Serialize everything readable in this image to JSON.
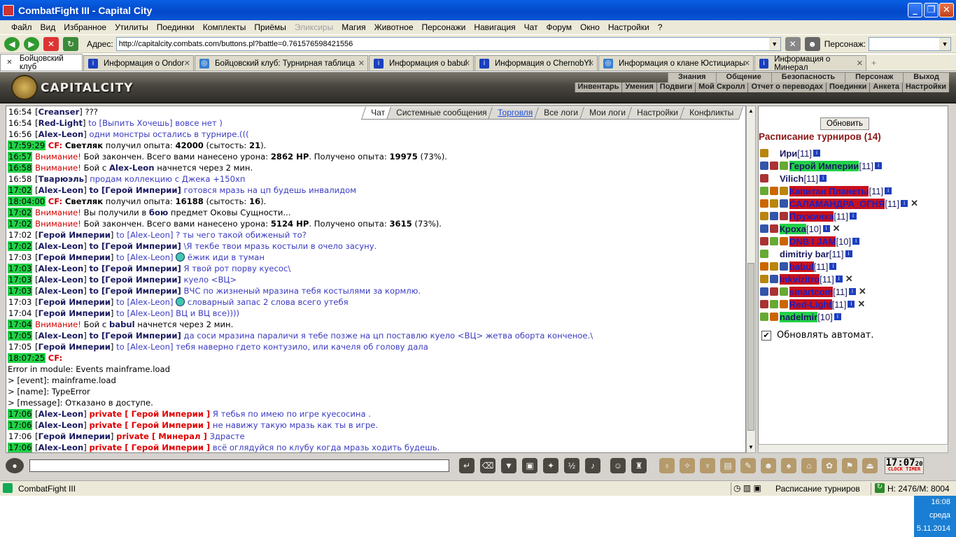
{
  "window": {
    "title": "CombatFight III - Capital City"
  },
  "menu": [
    "Файл",
    "Вид",
    "Избранное",
    "Утилиты",
    "Поединки",
    "Комплекты",
    "Приёмы",
    "Эликсиры",
    "Магия",
    "Животное",
    "Персонажи",
    "Навигация",
    "Чат",
    "Форум",
    "Окно",
    "Настройки",
    "?"
  ],
  "menu_disabled": [
    "Эликсиры"
  ],
  "address": {
    "label": "Адрес:",
    "url": "http://capitalcity.combats.com/buttons.pl?battle=0.761576598421556",
    "persona_label": "Персонаж:"
  },
  "tabs": [
    {
      "label": "Бойцовский клуб",
      "icon": "close-icon"
    },
    {
      "label": "Информация о Ondor",
      "icon": "info-icon"
    },
    {
      "label": "Бойцовский клуб: Турнирная таблица",
      "icon": "globe-icon"
    },
    {
      "label": "Информация о babul",
      "icon": "info-icon"
    },
    {
      "label": "Информация о ChernobYl",
      "icon": "info-icon"
    },
    {
      "label": "Информация о клане Юстициары",
      "icon": "globe-icon"
    },
    {
      "label": "Информация о Минерал",
      "icon": "info-icon"
    }
  ],
  "game": {
    "logo_text": "CAPITALCITY",
    "top_menu": [
      "Знания",
      "Общение",
      "Безопасность",
      "Персонаж",
      "Выход"
    ],
    "sub_menu": [
      "Инвентарь",
      "Умения",
      "Подвиги",
      "Мой Скролл",
      "Отчет о переводах",
      "Поединки",
      "Анкета",
      "Настройки"
    ],
    "chat_tabs": [
      "Чат",
      "Системные сообщения",
      "Торговля",
      "Все логи",
      "Мои логи",
      "Настройки",
      "Конфликты"
    ],
    "chat": [
      [
        {
          "c": "t",
          "v": "16:54"
        },
        {
          "v": " ["
        },
        {
          "c": "nk",
          "v": "Creanser"
        },
        {
          "v": "] ???"
        }
      ],
      [
        {
          "c": "t",
          "v": "16:54"
        },
        {
          "v": " ["
        },
        {
          "c": "nk",
          "v": "Red-Light"
        },
        {
          "v": "] "
        },
        {
          "c": "ms",
          "v": "to [Выпить Хочешь] вовсе нет )"
        }
      ],
      [
        {
          "c": "t",
          "v": "16:56"
        },
        {
          "v": " ["
        },
        {
          "c": "nk",
          "v": "Alex-Leon"
        },
        {
          "v": "] "
        },
        {
          "c": "ms",
          "v": "одни монстры остались в турнире.((("
        }
      ],
      [
        {
          "c": "t g",
          "v": "17:59:29"
        },
        {
          "v": " "
        },
        {
          "c": "cf",
          "v": "CF:"
        },
        {
          "v": " "
        },
        {
          "c": "b",
          "v": "Светляк"
        },
        {
          "v": " получил опыта: "
        },
        {
          "c": "b",
          "v": "42000"
        },
        {
          "v": " (сытость: "
        },
        {
          "c": "b",
          "v": "21"
        },
        {
          "v": ")."
        }
      ],
      [
        {
          "c": "t g",
          "v": "16:57"
        },
        {
          "v": " "
        },
        {
          "c": "wr",
          "v": "Внимание!"
        },
        {
          "v": " Бой закончен. Всего вами нанесено урона: "
        },
        {
          "c": "b",
          "v": "2862 HP"
        },
        {
          "v": ". Получено опыта: "
        },
        {
          "c": "b",
          "v": "19975"
        },
        {
          "v": " (73%)."
        }
      ],
      [
        {
          "c": "t g",
          "v": "16:58"
        },
        {
          "v": " "
        },
        {
          "c": "wr",
          "v": "Внимание!"
        },
        {
          "v": " Бой с "
        },
        {
          "c": "nk",
          "v": "Alex-Leon"
        },
        {
          "v": " начнется через 2 мин."
        }
      ],
      [
        {
          "c": "t",
          "v": "16:58"
        },
        {
          "v": " ["
        },
        {
          "c": "nk",
          "v": "Тварюэль"
        },
        {
          "v": "] "
        },
        {
          "c": "ms",
          "v": "продам коллекцию с Джека +150хп"
        }
      ],
      [
        {
          "c": "t g",
          "v": "17:02"
        },
        {
          "v": " ["
        },
        {
          "c": "nk",
          "v": "Alex-Leon"
        },
        {
          "v": "] "
        },
        {
          "c": "nk",
          "v": "to [Герой Империи]"
        },
        {
          "v": " "
        },
        {
          "c": "ms",
          "v": "готовся мразь на цп будешь инвалидом"
        }
      ],
      [
        {
          "c": "t g",
          "v": "18:04:00"
        },
        {
          "v": " "
        },
        {
          "c": "cf",
          "v": "CF:"
        },
        {
          "v": " "
        },
        {
          "c": "b",
          "v": "Светляк"
        },
        {
          "v": " получил опыта: "
        },
        {
          "c": "b",
          "v": "16188"
        },
        {
          "v": " (сытость: "
        },
        {
          "c": "b",
          "v": "16"
        },
        {
          "v": ")."
        }
      ],
      [
        {
          "c": "t g",
          "v": "17:02"
        },
        {
          "v": " "
        },
        {
          "c": "wr",
          "v": "Внимание!"
        },
        {
          "v": " Вы получили в "
        },
        {
          "c": "nk",
          "v": "бою"
        },
        {
          "v": " предмет Оковы Сущности..."
        }
      ],
      [
        {
          "c": "t g",
          "v": "17:02"
        },
        {
          "v": " "
        },
        {
          "c": "wr",
          "v": "Внимание!"
        },
        {
          "v": " Бой закончен. Всего вами нанесено урона: "
        },
        {
          "c": "b",
          "v": "5124 HP"
        },
        {
          "v": ". Получено опыта: "
        },
        {
          "c": "b",
          "v": "3615"
        },
        {
          "v": " (73%)."
        }
      ],
      [
        {
          "c": "t",
          "v": "17:02"
        },
        {
          "v": " ["
        },
        {
          "c": "nk",
          "v": "Герой Империи"
        },
        {
          "v": "] "
        },
        {
          "c": "ms",
          "v": "to [Alex-Leon] ? ты чего такой обиженый то?"
        }
      ],
      [
        {
          "c": "t g",
          "v": "17:02"
        },
        {
          "v": " ["
        },
        {
          "c": "nk",
          "v": "Alex-Leon"
        },
        {
          "v": "] "
        },
        {
          "c": "nk",
          "v": "to [Герой Империи]"
        },
        {
          "v": " "
        },
        {
          "c": "ms",
          "v": "\\Я текбе твои мразь костыли в очело засуну."
        }
      ],
      [
        {
          "c": "t",
          "v": "17:03"
        },
        {
          "v": " ["
        },
        {
          "c": "nk",
          "v": "Герой Империи"
        },
        {
          "v": "] "
        },
        {
          "c": "ms",
          "v": "to [Alex-Leon] "
        },
        {
          "c": "em",
          "v": ""
        },
        {
          "c": "ms",
          "v": " ёжик иди в туман"
        }
      ],
      [
        {
          "c": "t g",
          "v": "17:03"
        },
        {
          "v": " ["
        },
        {
          "c": "nk",
          "v": "Alex-Leon"
        },
        {
          "v": "] "
        },
        {
          "c": "nk",
          "v": "to [Герой Империи]"
        },
        {
          "v": " "
        },
        {
          "c": "ms",
          "v": "Я твой рот порву куесос\\"
        }
      ],
      [
        {
          "c": "t g",
          "v": "17:03"
        },
        {
          "v": " ["
        },
        {
          "c": "nk",
          "v": "Alex-Leon"
        },
        {
          "v": "] "
        },
        {
          "c": "nk",
          "v": "to [Герой Империи]"
        },
        {
          "v": " "
        },
        {
          "c": "ms",
          "v": "куело <ВЦ>"
        }
      ],
      [
        {
          "c": "t g",
          "v": "17:03"
        },
        {
          "v": " ["
        },
        {
          "c": "nk",
          "v": "Alex-Leon"
        },
        {
          "v": "] "
        },
        {
          "c": "nk",
          "v": "to [Герой Империи]"
        },
        {
          "v": " "
        },
        {
          "c": "ms",
          "v": "ВЧС по жизненый мразина тебя костылями за кормлю."
        }
      ],
      [
        {
          "c": "t",
          "v": "17:03"
        },
        {
          "v": " ["
        },
        {
          "c": "nk",
          "v": "Герой Империи"
        },
        {
          "v": "] "
        },
        {
          "c": "ms",
          "v": "to [Alex-Leon] "
        },
        {
          "c": "em",
          "v": ""
        },
        {
          "c": "ms",
          "v": " словарный запас 2 слова всего утебя"
        }
      ],
      [
        {
          "c": "t",
          "v": "17:04"
        },
        {
          "v": " ["
        },
        {
          "c": "nk",
          "v": "Герой Империи"
        },
        {
          "v": "] "
        },
        {
          "c": "ms",
          "v": "to [Alex-Leon] ВЦ и ВЦ все))))"
        }
      ],
      [
        {
          "c": "t g",
          "v": "17:04"
        },
        {
          "v": " "
        },
        {
          "c": "wr",
          "v": "Внимание!"
        },
        {
          "v": " Бой с "
        },
        {
          "c": "nk",
          "v": "babul"
        },
        {
          "v": " начнется через 2 мин."
        }
      ],
      [
        {
          "c": "t g",
          "v": "17:05"
        },
        {
          "v": " ["
        },
        {
          "c": "nk",
          "v": "Alex-Leon"
        },
        {
          "v": "] "
        },
        {
          "c": "nk",
          "v": "to [Герой Империи]"
        },
        {
          "v": " "
        },
        {
          "c": "ms",
          "v": "да соси мразина параличи я тебе позже на цп поставлю куело <ВЦ> жетва оборта конченое.\\"
        }
      ],
      [
        {
          "c": "t",
          "v": "17:05"
        },
        {
          "v": " ["
        },
        {
          "c": "nk",
          "v": "Герой Империи"
        },
        {
          "v": "] "
        },
        {
          "c": "ms",
          "v": "to [Alex-Leon] тебя наверно гдето контузило, или качеля об голову дала"
        }
      ],
      [
        {
          "c": "t g",
          "v": "18:07:25"
        },
        {
          "v": " "
        },
        {
          "c": "cf",
          "v": "CF:"
        }
      ],
      [
        {
          "v": "Error in module: Events mainframe.load"
        }
      ],
      [
        {
          "v": "> [event]: mainframe.load"
        }
      ],
      [
        {
          "v": "> [name]: TypeError"
        }
      ],
      [
        {
          "v": "> [message]: Отказано в доступе."
        }
      ],
      [
        {
          "c": "t g",
          "v": "17:06"
        },
        {
          "v": " ["
        },
        {
          "c": "nk",
          "v": "Alex-Leon"
        },
        {
          "v": "] "
        },
        {
          "c": "pv",
          "v": "private [ Герой Империи ]"
        },
        {
          "v": " "
        },
        {
          "c": "ms",
          "v": "Я тебья по имею по игре куесосина ."
        }
      ],
      [
        {
          "c": "t g",
          "v": "17:06"
        },
        {
          "v": " ["
        },
        {
          "c": "nk",
          "v": "Alex-Leon"
        },
        {
          "v": "] "
        },
        {
          "c": "pv",
          "v": "private [ Герой Империи ]"
        },
        {
          "v": " "
        },
        {
          "c": "ms",
          "v": "не навижу такую мразь как ты в игре."
        }
      ],
      [
        {
          "c": "t",
          "v": "17:06"
        },
        {
          "v": " ["
        },
        {
          "c": "nk",
          "v": "Герой Империи"
        },
        {
          "v": "] "
        },
        {
          "c": "pv",
          "v": "private [ Минерал ]"
        },
        {
          "v": " "
        },
        {
          "c": "ms",
          "v": "Здрасте"
        }
      ],
      [
        {
          "c": "t g",
          "v": "17:06"
        },
        {
          "v": " ["
        },
        {
          "c": "nk",
          "v": "Alex-Leon"
        },
        {
          "v": "] "
        },
        {
          "c": "pv",
          "v": "private [ Герой Империи ]"
        },
        {
          "v": " "
        },
        {
          "c": "ms",
          "v": "всё оглядуйся по клубу когда мразь ходить будешь."
        }
      ]
    ],
    "schedule": {
      "refresh_label": "Обновить",
      "title": "Расписание турниров (14)",
      "players": [
        {
          "name": "Ири",
          "level": "[11]",
          "style": "plain",
          "icons": 1,
          "x": false
        },
        {
          "name": "Герой Империи",
          "level": "[11]",
          "style": "grn",
          "icons": 3,
          "x": false
        },
        {
          "name": "Vilich",
          "level": "[11]",
          "style": "plain",
          "icons": 1,
          "x": false
        },
        {
          "name": "Капитан Планеты",
          "level": "[11]",
          "style": "red",
          "icons": 3,
          "x": false
        },
        {
          "name": "САЛАМАНДРА_ОГНЯ",
          "level": "[11]",
          "style": "red",
          "icons": 3,
          "x": true
        },
        {
          "name": "Пружинка",
          "level": "[11]",
          "style": "red",
          "icons": 3,
          "x": false
        },
        {
          "name": "Кроха",
          "level": "[10]",
          "style": "grn",
          "icons": 2,
          "x": true
        },
        {
          "name": "DNB I JAM",
          "level": "[10]",
          "style": "red",
          "icons": 3,
          "x": false
        },
        {
          "name": "dimitriy bar",
          "level": "[11]",
          "style": "plain",
          "icons": 1,
          "x": false
        },
        {
          "name": "babul",
          "level": "[11]",
          "style": "red",
          "icons": 3,
          "x": false
        },
        {
          "name": "Inkvizitro",
          "level": "[11]",
          "style": "red",
          "icons": 2,
          "x": true
        },
        {
          "name": "smartcom",
          "level": "[11]",
          "style": "red",
          "icons": 3,
          "x": true
        },
        {
          "name": "Red-Light",
          "level": "[11]",
          "style": "red",
          "icons": 3,
          "x": true
        },
        {
          "name": "nadelmir",
          "level": "[10]",
          "style": "grn",
          "icons": 2,
          "x": false
        }
      ],
      "auto_label": "Обновлять автомат."
    },
    "clock": {
      "time": "17:07",
      "sec": "20",
      "labels": "CLOCK TIMER"
    }
  },
  "status": {
    "app": "CombatFight III",
    "panel": "Расписание турниров",
    "memory": "H: 2476/M: 8004"
  },
  "tray": {
    "time": "16:08",
    "day": "среда",
    "date": "5.11.2014"
  }
}
